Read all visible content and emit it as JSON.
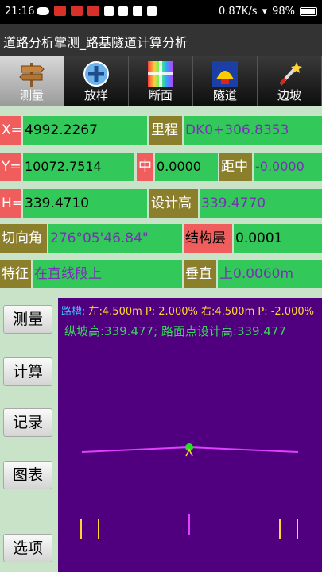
{
  "status_bar": {
    "time": "21:16",
    "net_speed": "0.87K/s",
    "battery": "98%",
    "icons": [
      "cloud-icon",
      "notification-icon",
      "notification-icon",
      "notification-icon",
      "app-icon",
      "app-icon",
      "app-icon",
      "app-icon"
    ]
  },
  "app_title": "道路分析掌测_路基隧道计算分析",
  "tabs": [
    {
      "label": "测量",
      "icon": "signpost-icon",
      "active": true
    },
    {
      "label": "放样",
      "icon": "plus-circle-icon",
      "active": false
    },
    {
      "label": "断面",
      "icon": "color-grid-icon",
      "active": false
    },
    {
      "label": "隧道",
      "icon": "shell-icon",
      "active": false
    },
    {
      "label": "边坡",
      "icon": "magic-wand-icon",
      "active": false
    }
  ],
  "fields": {
    "x_label": "X=",
    "x_value": "4992.2267",
    "mileage_label": "里程",
    "mileage_value": "DK0+306.8353",
    "y_label": "Y=",
    "y_value": "10072.7514",
    "center_label": "中",
    "center_value": "0.0000",
    "dist_label": "距中",
    "dist_value": "-0.0000",
    "h_label": "H=",
    "h_value": "339.4710",
    "design_h_label": "设计高",
    "design_h_value": "339.4770",
    "tangent_label": "切向角",
    "tangent_value": "276°05'46.84\"",
    "struct_label": "结构层",
    "struct_value": "0.0001",
    "feature_label": "特征",
    "feature_value": "在直线段上",
    "vertical_label": "垂直",
    "vertical_value": "上0.0060m"
  },
  "side_buttons": {
    "measure": "测量",
    "calculate": "计算",
    "record": "记录",
    "chart": "图表",
    "options": "选项"
  },
  "panel": {
    "line1_key": "路槽:",
    "line1_text": " 左:4.500m P: 2.000% 右:4.500m P: -2.000%",
    "line2_text": "纵坡高:339.477; 路面点设计高:339.477"
  },
  "colors": {
    "label_red": "#ef5d5d",
    "value_green": "#33c95a",
    "label_olive": "#8c7f2c",
    "panel_bg": "#50007f",
    "road_line": "#e040ff",
    "point": "#22e020",
    "marker": "#ffd630"
  }
}
